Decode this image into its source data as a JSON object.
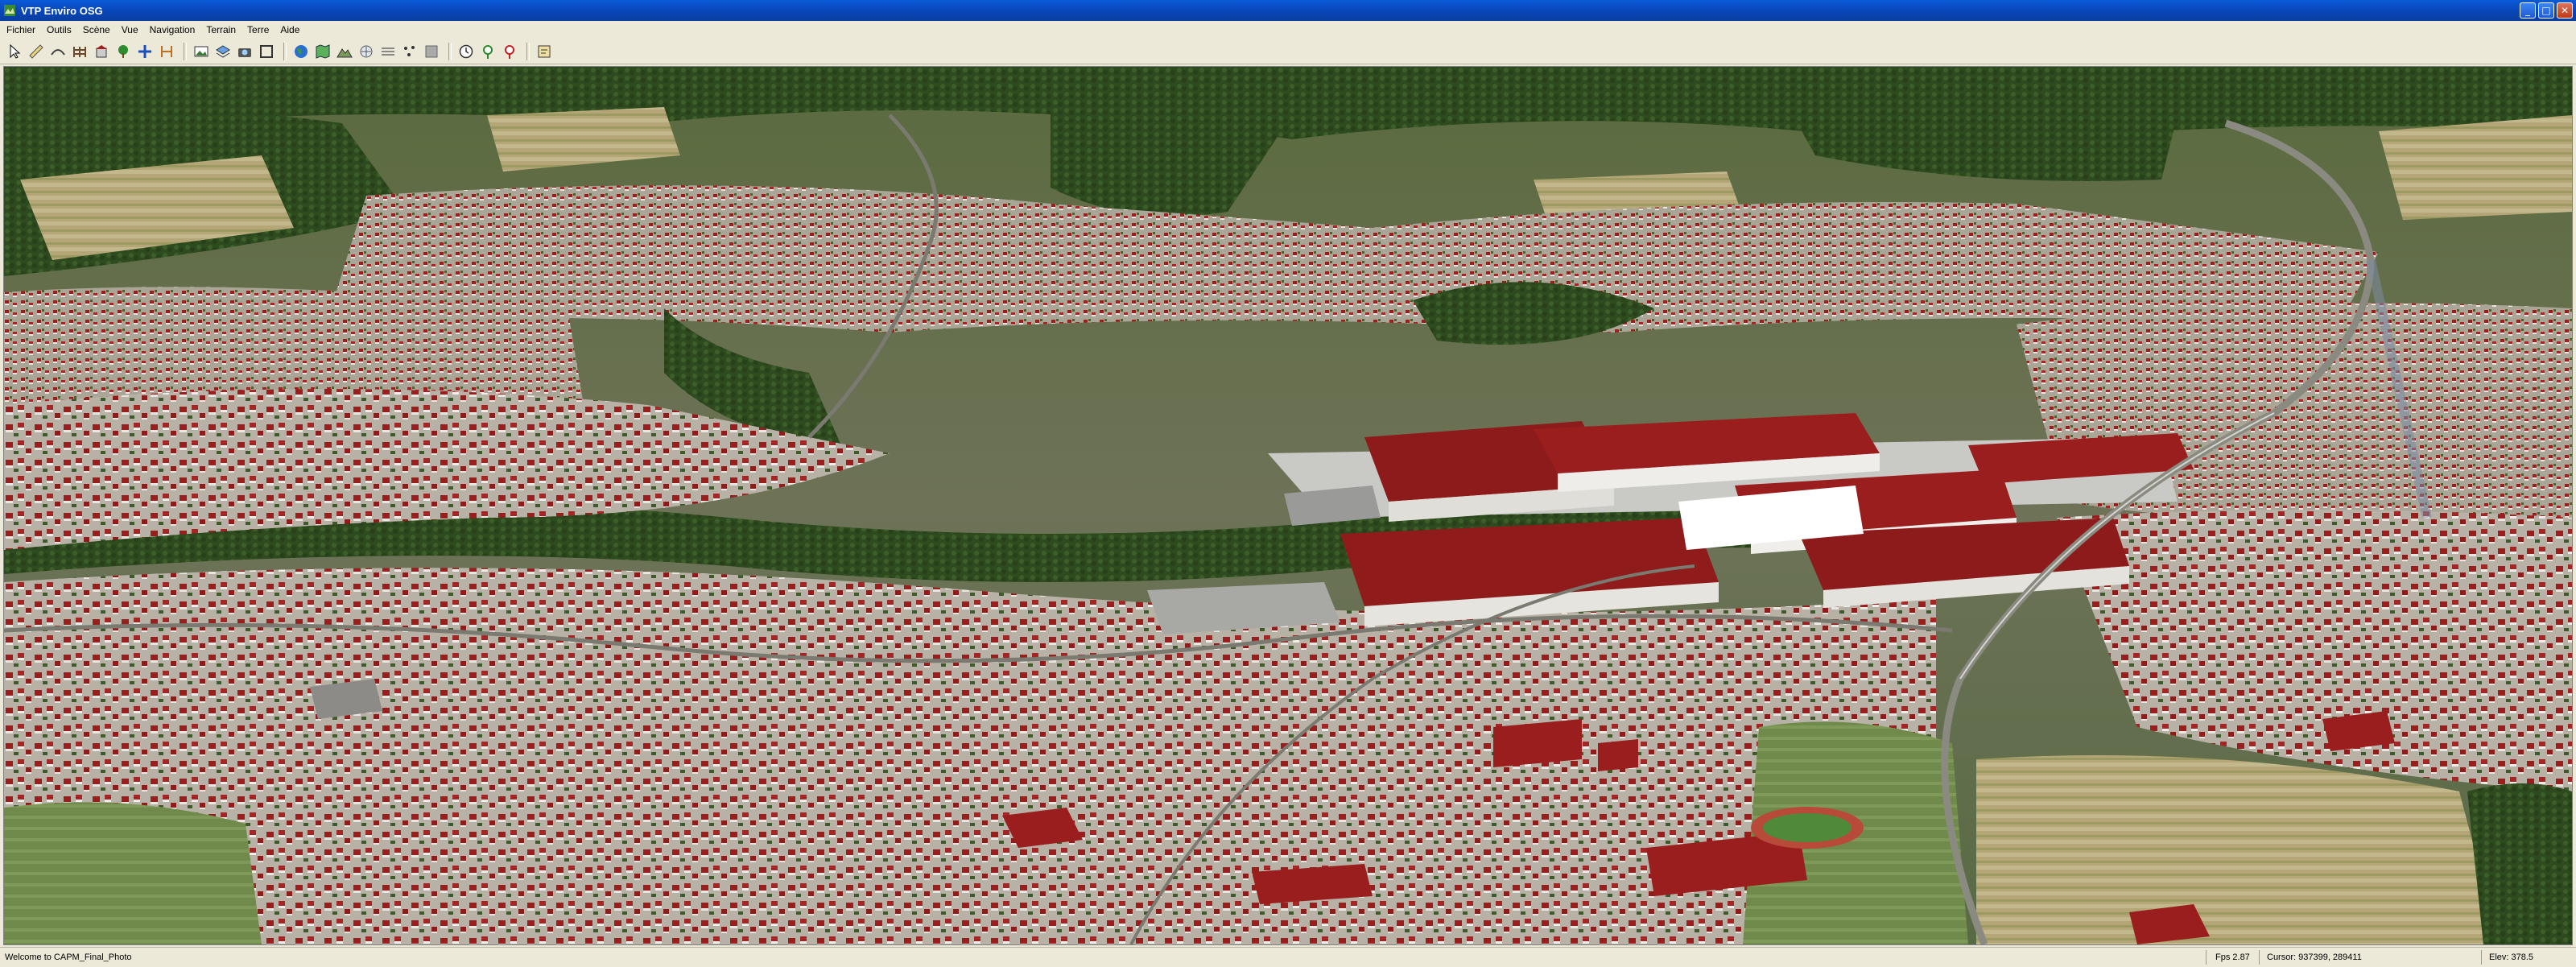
{
  "window": {
    "title": "VTP Enviro OSG"
  },
  "menu": [
    "Fichier",
    "Outils",
    "Scène",
    "Vue",
    "Navigation",
    "Terrain",
    "Terre",
    "Aide"
  ],
  "toolbar": {
    "buttons": [
      "select-tool-icon",
      "ruler-icon",
      "fly-icon",
      "fence-icon",
      "building-icon",
      "tree-icon",
      "move-icon",
      "route-icon",
      "snapshot-icon",
      "layers-icon",
      "camera-icon",
      "maximize-icon",
      "globe-icon",
      "map-icon",
      "terrain-icon",
      "sky-icon",
      "fog-icon",
      "time-icon",
      "location-icon",
      "scenario-icon"
    ]
  },
  "status": {
    "message": "Welcome to CAPM_Final_Photo",
    "fps": "Fps 2.87",
    "cursor": "Cursor: 937399,  289411",
    "elev": "Elev: 378.5"
  },
  "colors": {
    "title_bar": "#0a5bd8",
    "roof": "#9a1e1e",
    "forest": "#2f4f1e",
    "field": "#b8a76e",
    "road": "#7a7a70"
  }
}
